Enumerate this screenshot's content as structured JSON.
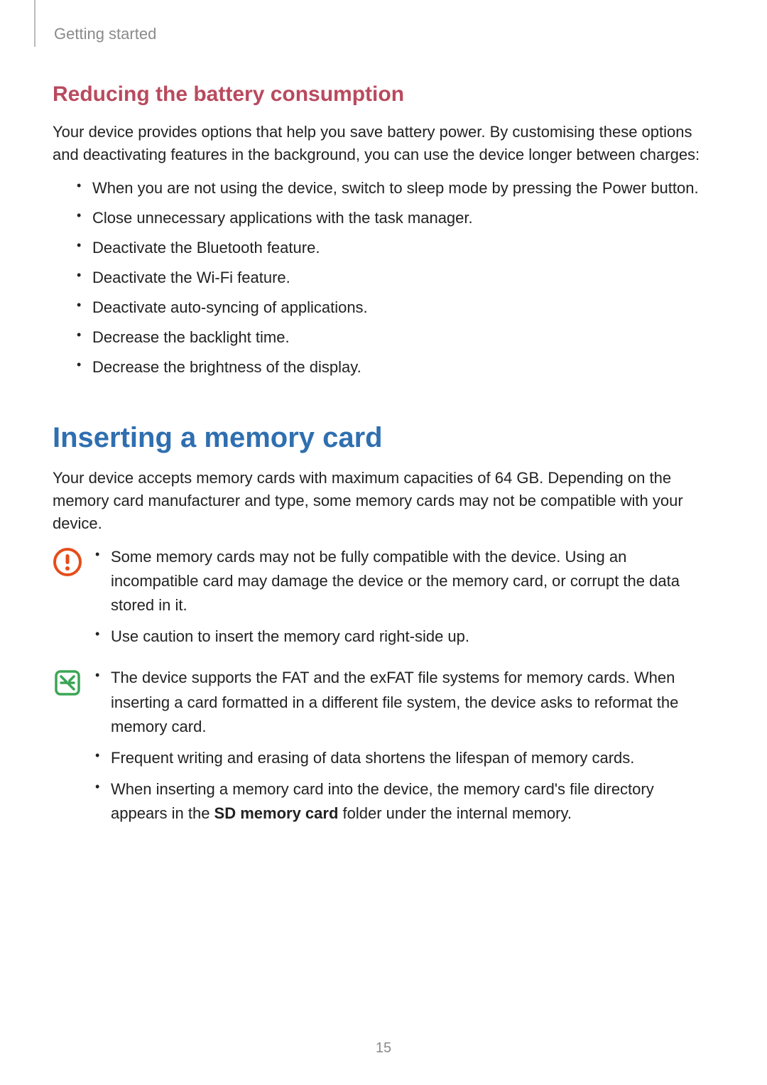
{
  "header": {
    "chapter": "Getting started"
  },
  "section1": {
    "title": "Reducing the battery consumption",
    "intro": "Your device provides options that help you save battery power. By customising these options and deactivating features in the background, you can use the device longer between charges:",
    "items": [
      "When you are not using the device, switch to sleep mode by pressing the Power button.",
      "Close unnecessary applications with the task manager.",
      "Deactivate the Bluetooth feature.",
      "Deactivate the Wi-Fi feature.",
      "Deactivate auto-syncing of applications.",
      "Decrease the backlight time.",
      "Decrease the brightness of the display."
    ]
  },
  "section2": {
    "title": "Inserting a memory card",
    "intro": "Your device accepts memory cards with maximum capacities of 64 GB. Depending on the memory card manufacturer and type, some memory cards may not be compatible with your device.",
    "warning": {
      "items": [
        "Some memory cards may not be fully compatible with the device. Using an incompatible card may damage the device or the memory card, or corrupt the data stored in it.",
        "Use caution to insert the memory card right-side up."
      ]
    },
    "note": {
      "items_pre_bold": [
        "The device supports the FAT and the exFAT file systems for memory cards. When inserting a card formatted in a different file system, the device asks to reformat the memory card.",
        "Frequent writing and erasing of data shortens the lifespan of memory cards."
      ],
      "last_item": {
        "pre": "When inserting a memory card into the device, the memory card's file directory appears in the ",
        "bold": "SD memory card",
        "post": " folder under the internal memory."
      }
    }
  },
  "page_number": "15",
  "colors": {
    "accent_red": "#b94a5e",
    "accent_blue": "#2f6fb0",
    "warn_orange": "#e54d1b",
    "note_green": "#3aa655"
  }
}
